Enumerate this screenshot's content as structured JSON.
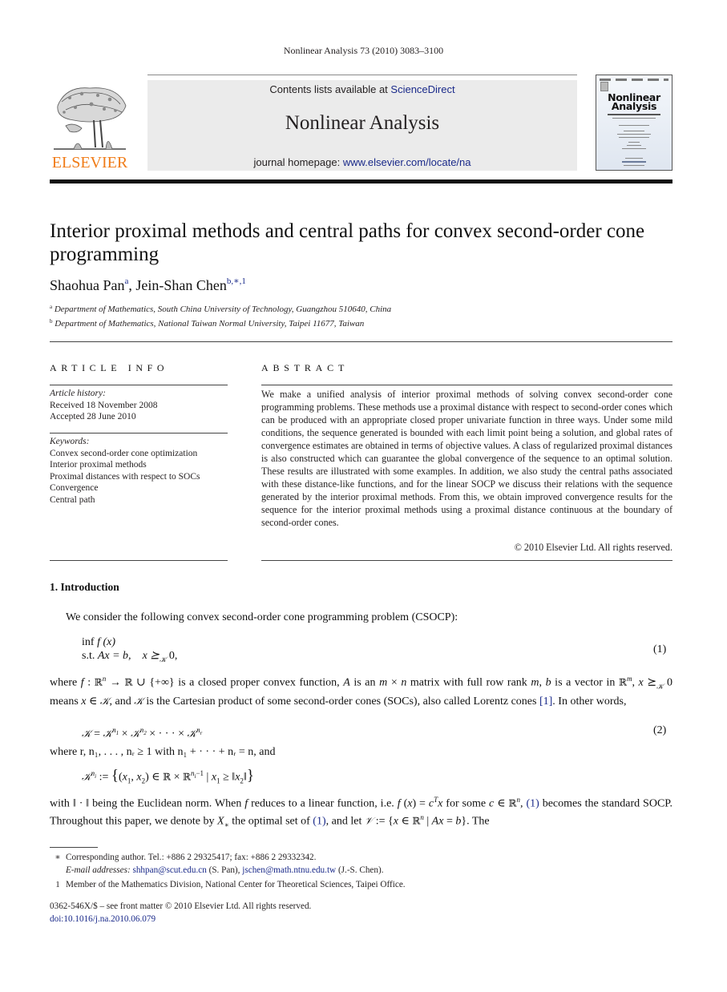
{
  "running_head": "Nonlinear Analysis 73 (2010) 3083–3100",
  "masthead": {
    "publisher_name": "ELSEVIER",
    "contents_prefix": "Contents lists available at ",
    "contents_link": "ScienceDirect",
    "journal_name": "Nonlinear Analysis",
    "homepage_prefix": "journal homepage: ",
    "homepage_link": "www.elsevier.com/locate/na",
    "cover_title_line1": "Nonlinear",
    "cover_title_line2": "Analysis",
    "colors": {
      "publisher_orange": "#f07c18",
      "link_blue": "#1a2a8a",
      "masthead_gray": "#ebebeb"
    }
  },
  "article": {
    "title": "Interior proximal methods and central paths for convex second-order cone programming",
    "authors": [
      {
        "name": "Shaohua Pan",
        "marks": "a"
      },
      {
        "name": "Jein-Shan Chen",
        "marks": "b,∗,1"
      }
    ],
    "author_separator": ", ",
    "affiliations": [
      {
        "mark": "a",
        "text": "Department of Mathematics, South China University of Technology, Guangzhou 510640, China"
      },
      {
        "mark": "b",
        "text": "Department of Mathematics, National Taiwan Normal University, Taipei 11677, Taiwan"
      }
    ]
  },
  "article_info": {
    "heading": "ARTICLE INFO",
    "history_label": "Article history:",
    "history": [
      "Received 18 November 2008",
      "Accepted 28 June 2010"
    ],
    "keywords_label": "Keywords:",
    "keywords": [
      "Convex second-order cone optimization",
      "Interior proximal methods",
      "Proximal distances with respect to SOCs",
      "Convergence",
      "Central path"
    ]
  },
  "abstract": {
    "heading": "ABSTRACT",
    "text": "We make a unified analysis of interior proximal methods of solving convex second-order cone programming problems. These methods use a proximal distance with respect to second-order cones which can be produced with an appropriate closed proper univariate function in three ways. Under some mild conditions, the sequence generated is bounded with each limit point being a solution, and global rates of convergence estimates are obtained in terms of objective values. A class of regularized proximal distances is also constructed which can guarantee the global convergence of the sequence to an optimal solution. These results are illustrated with some examples. In addition, we also study the central paths associated with these distance-like functions, and for the linear SOCP we discuss their relations with the sequence generated by the interior proximal methods. From this, we obtain improved convergence results for the sequence for the interior proximal methods using a proximal distance continuous at the boundary of second-order cones.",
    "copyright": "© 2010 Elsevier Ltd. All rights reserved."
  },
  "section": {
    "number_title": "1.  Introduction",
    "p1": "We consider the following convex second-order cone programming problem (CSOCP):",
    "eq1_line1_a": "inf ",
    "eq1_line1_b": "f",
    "eq1_line1_c": " (x)",
    "eq1_line2_a": "s.t. ",
    "eq1_line2_b": "Ax = b,",
    "eq1_line2_c": "x ⪰",
    "eq1_line2_d": "𝒦",
    "eq1_line2_e": " 0,",
    "eq1_number": "(1)",
    "eq2_number": "(2)",
    "p2_text_1": " is a closed proper convex function, ",
    "p2_text_2": " is an ",
    "p2_text_3": " matrix with full row rank ",
    "p2_text_4": " is a vector in ",
    "p2_text_5": " 0 means ",
    "p2_text_6": ", and ",
    "p2_text_7": " is the Cartesian product of some second-order cones (SOCs), also called Lorentz cones ",
    "p2_ref": "[1]",
    "p2_text_8": ". In other words,",
    "p3_text": "where r, n₁, . . . , nᵣ ≥ 1 with n₁ + · · · + nᵣ = n, and",
    "p4_text_1": "with ‖ · ‖ being the Euclidean norm. When ",
    "p4_text_2": " reduces to a linear function, i.e. ",
    "p4_text_3": " for some ",
    "p4_ref1": "(1)",
    "p4_text_4": " becomes the standard SOCP. Throughout this paper, we denote by ",
    "p4_text_5": " the optimal set of ",
    "p4_ref2": "(1)",
    "p4_text_6": ", and let ",
    "p4_text_7": ". The"
  },
  "footnotes": {
    "star_mark": "∗",
    "star_text": "Corresponding author. Tel.: +886 2 29325417; fax: +886 2 29332342.",
    "email_label": "E-mail addresses:",
    "email1": "shhpan@scut.edu.cn",
    "email1_owner": " (S. Pan), ",
    "email2": "jschen@math.ntnu.edu.tw",
    "email2_owner": " (J.-S. Chen).",
    "one_mark": "1",
    "one_text": "Member of the Mathematics Division, National Center for Theoretical Sciences, Taipei Office.",
    "front_matter": "0362-546X/$ – see front matter © 2010 Elsevier Ltd. All rights reserved.",
    "doi": "doi:10.1016/j.na.2010.06.079"
  }
}
